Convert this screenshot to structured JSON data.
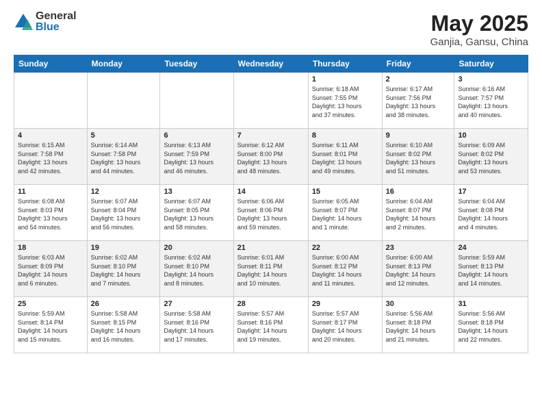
{
  "logo": {
    "general": "General",
    "blue": "Blue"
  },
  "title": {
    "month": "May 2025",
    "location": "Ganjia, Gansu, China"
  },
  "weekdays": [
    "Sunday",
    "Monday",
    "Tuesday",
    "Wednesday",
    "Thursday",
    "Friday",
    "Saturday"
  ],
  "rows": [
    [
      {
        "day": "",
        "info": ""
      },
      {
        "day": "",
        "info": ""
      },
      {
        "day": "",
        "info": ""
      },
      {
        "day": "",
        "info": ""
      },
      {
        "day": "1",
        "info": "Sunrise: 6:18 AM\nSunset: 7:55 PM\nDaylight: 13 hours\nand 37 minutes."
      },
      {
        "day": "2",
        "info": "Sunrise: 6:17 AM\nSunset: 7:56 PM\nDaylight: 13 hours\nand 38 minutes."
      },
      {
        "day": "3",
        "info": "Sunrise: 6:16 AM\nSunset: 7:57 PM\nDaylight: 13 hours\nand 40 minutes."
      }
    ],
    [
      {
        "day": "4",
        "info": "Sunrise: 6:15 AM\nSunset: 7:58 PM\nDaylight: 13 hours\nand 42 minutes."
      },
      {
        "day": "5",
        "info": "Sunrise: 6:14 AM\nSunset: 7:58 PM\nDaylight: 13 hours\nand 44 minutes."
      },
      {
        "day": "6",
        "info": "Sunrise: 6:13 AM\nSunset: 7:59 PM\nDaylight: 13 hours\nand 46 minutes."
      },
      {
        "day": "7",
        "info": "Sunrise: 6:12 AM\nSunset: 8:00 PM\nDaylight: 13 hours\nand 48 minutes."
      },
      {
        "day": "8",
        "info": "Sunrise: 6:11 AM\nSunset: 8:01 PM\nDaylight: 13 hours\nand 49 minutes."
      },
      {
        "day": "9",
        "info": "Sunrise: 6:10 AM\nSunset: 8:02 PM\nDaylight: 13 hours\nand 51 minutes."
      },
      {
        "day": "10",
        "info": "Sunrise: 6:09 AM\nSunset: 8:02 PM\nDaylight: 13 hours\nand 53 minutes."
      }
    ],
    [
      {
        "day": "11",
        "info": "Sunrise: 6:08 AM\nSunset: 8:03 PM\nDaylight: 13 hours\nand 54 minutes."
      },
      {
        "day": "12",
        "info": "Sunrise: 6:07 AM\nSunset: 8:04 PM\nDaylight: 13 hours\nand 56 minutes."
      },
      {
        "day": "13",
        "info": "Sunrise: 6:07 AM\nSunset: 8:05 PM\nDaylight: 13 hours\nand 58 minutes."
      },
      {
        "day": "14",
        "info": "Sunrise: 6:06 AM\nSunset: 8:06 PM\nDaylight: 13 hours\nand 59 minutes."
      },
      {
        "day": "15",
        "info": "Sunrise: 6:05 AM\nSunset: 8:07 PM\nDaylight: 14 hours\nand 1 minute."
      },
      {
        "day": "16",
        "info": "Sunrise: 6:04 AM\nSunset: 8:07 PM\nDaylight: 14 hours\nand 2 minutes."
      },
      {
        "day": "17",
        "info": "Sunrise: 6:04 AM\nSunset: 8:08 PM\nDaylight: 14 hours\nand 4 minutes."
      }
    ],
    [
      {
        "day": "18",
        "info": "Sunrise: 6:03 AM\nSunset: 8:09 PM\nDaylight: 14 hours\nand 6 minutes."
      },
      {
        "day": "19",
        "info": "Sunrise: 6:02 AM\nSunset: 8:10 PM\nDaylight: 14 hours\nand 7 minutes."
      },
      {
        "day": "20",
        "info": "Sunrise: 6:02 AM\nSunset: 8:10 PM\nDaylight: 14 hours\nand 8 minutes."
      },
      {
        "day": "21",
        "info": "Sunrise: 6:01 AM\nSunset: 8:11 PM\nDaylight: 14 hours\nand 10 minutes."
      },
      {
        "day": "22",
        "info": "Sunrise: 6:00 AM\nSunset: 8:12 PM\nDaylight: 14 hours\nand 11 minutes."
      },
      {
        "day": "23",
        "info": "Sunrise: 6:00 AM\nSunset: 8:13 PM\nDaylight: 14 hours\nand 12 minutes."
      },
      {
        "day": "24",
        "info": "Sunrise: 5:59 AM\nSunset: 8:13 PM\nDaylight: 14 hours\nand 14 minutes."
      }
    ],
    [
      {
        "day": "25",
        "info": "Sunrise: 5:59 AM\nSunset: 8:14 PM\nDaylight: 14 hours\nand 15 minutes."
      },
      {
        "day": "26",
        "info": "Sunrise: 5:58 AM\nSunset: 8:15 PM\nDaylight: 14 hours\nand 16 minutes."
      },
      {
        "day": "27",
        "info": "Sunrise: 5:58 AM\nSunset: 8:16 PM\nDaylight: 14 hours\nand 17 minutes."
      },
      {
        "day": "28",
        "info": "Sunrise: 5:57 AM\nSunset: 8:16 PM\nDaylight: 14 hours\nand 19 minutes."
      },
      {
        "day": "29",
        "info": "Sunrise: 5:57 AM\nSunset: 8:17 PM\nDaylight: 14 hours\nand 20 minutes."
      },
      {
        "day": "30",
        "info": "Sunrise: 5:56 AM\nSunset: 8:18 PM\nDaylight: 14 hours\nand 21 minutes."
      },
      {
        "day": "31",
        "info": "Sunrise: 5:56 AM\nSunset: 8:18 PM\nDaylight: 14 hours\nand 22 minutes."
      }
    ]
  ]
}
